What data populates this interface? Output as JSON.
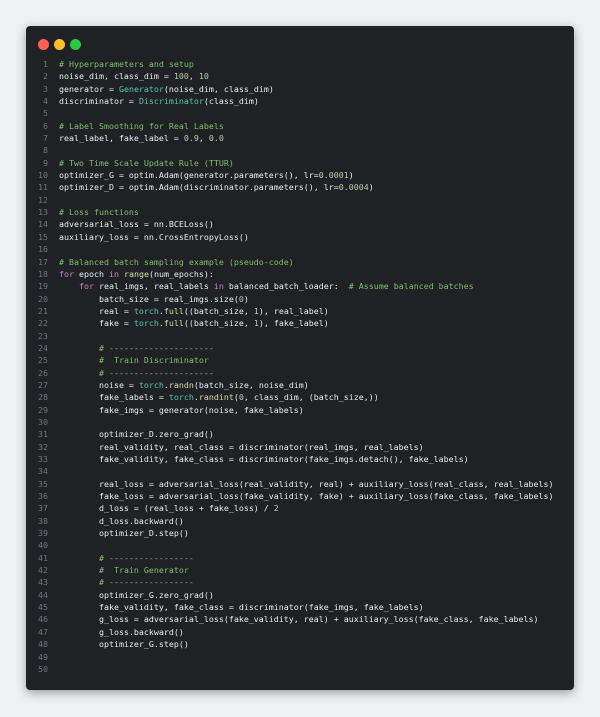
{
  "window": {
    "controls": [
      "close",
      "minimize",
      "zoom"
    ],
    "colors": {
      "close": "#ff5f56",
      "minimize": "#ffbd2e",
      "zoom": "#27c93f",
      "background": "#1f2124"
    }
  },
  "code": {
    "lines": [
      {
        "n": "1",
        "t": [
          [
            "c",
            "# Hyperparameters and setup"
          ]
        ]
      },
      {
        "n": "2",
        "t": [
          [
            "p",
            "noise_dim, class_dim = "
          ],
          [
            "n",
            "100"
          ],
          [
            "p",
            ", "
          ],
          [
            "n",
            "10"
          ]
        ]
      },
      {
        "n": "3",
        "t": [
          [
            "p",
            "generator = "
          ],
          [
            "t",
            "Generator"
          ],
          [
            "p",
            "(noise_dim, class_dim)"
          ]
        ]
      },
      {
        "n": "4",
        "t": [
          [
            "p",
            "discriminator = "
          ],
          [
            "t",
            "Discriminator"
          ],
          [
            "p",
            "(class_dim)"
          ]
        ]
      },
      {
        "n": "5",
        "t": []
      },
      {
        "n": "6",
        "t": [
          [
            "c",
            "# Label Smoothing for Real Labels"
          ]
        ]
      },
      {
        "n": "7",
        "t": [
          [
            "p",
            "real_label, fake_label = "
          ],
          [
            "n",
            "0.9"
          ],
          [
            "p",
            ", "
          ],
          [
            "n",
            "0.0"
          ]
        ]
      },
      {
        "n": "8",
        "t": []
      },
      {
        "n": "9",
        "t": [
          [
            "c",
            "# Two Time Scale Update Rule (TTUR)"
          ]
        ]
      },
      {
        "n": "10",
        "t": [
          [
            "p",
            "optimizer_G = optim.Adam(generator.parameters(), lr="
          ],
          [
            "n",
            "0.0001"
          ],
          [
            "p",
            ")"
          ]
        ]
      },
      {
        "n": "11",
        "t": [
          [
            "p",
            "optimizer_D = optim.Adam(discriminator.parameters(), lr="
          ],
          [
            "n",
            "0.0004"
          ],
          [
            "p",
            ")"
          ]
        ]
      },
      {
        "n": "12",
        "t": []
      },
      {
        "n": "13",
        "t": [
          [
            "c",
            "# Loss functions"
          ]
        ]
      },
      {
        "n": "14",
        "t": [
          [
            "p",
            "adversarial_loss = nn.BCELoss()"
          ]
        ]
      },
      {
        "n": "15",
        "t": [
          [
            "p",
            "auxiliary_loss = nn.CrossEntropyLoss()"
          ]
        ]
      },
      {
        "n": "16",
        "t": []
      },
      {
        "n": "17",
        "t": [
          [
            "c",
            "# Balanced batch sampling example (pseudo-code)"
          ]
        ]
      },
      {
        "n": "18",
        "t": [
          [
            "k",
            "for"
          ],
          [
            "p",
            " epoch "
          ],
          [
            "k",
            "in"
          ],
          [
            "p",
            " "
          ],
          [
            "f",
            "range"
          ],
          [
            "p",
            "(num_epochs):"
          ]
        ]
      },
      {
        "n": "19",
        "t": [
          [
            "p",
            "    "
          ],
          [
            "k",
            "for"
          ],
          [
            "p",
            " real_imgs, real_labels "
          ],
          [
            "k",
            "in"
          ],
          [
            "p",
            " balanced_batch_loader:  "
          ],
          [
            "c",
            "# Assume balanced batches"
          ]
        ]
      },
      {
        "n": "20",
        "t": [
          [
            "p",
            "        batch_size = real_imgs.size("
          ],
          [
            "n",
            "0"
          ],
          [
            "p",
            ")"
          ]
        ]
      },
      {
        "n": "21",
        "t": [
          [
            "p",
            "        real = "
          ],
          [
            "t",
            "torch"
          ],
          [
            "p",
            "."
          ],
          [
            "f",
            "full"
          ],
          [
            "p",
            "((batch_size, "
          ],
          [
            "n",
            "1"
          ],
          [
            "p",
            "), real_label)"
          ]
        ]
      },
      {
        "n": "22",
        "t": [
          [
            "p",
            "        fake = "
          ],
          [
            "t",
            "torch"
          ],
          [
            "p",
            "."
          ],
          [
            "f",
            "full"
          ],
          [
            "p",
            "((batch_size, "
          ],
          [
            "n",
            "1"
          ],
          [
            "p",
            "), fake_label)"
          ]
        ]
      },
      {
        "n": "23",
        "t": []
      },
      {
        "n": "24",
        "t": [
          [
            "p",
            "        "
          ],
          [
            "c",
            "# ---------------------"
          ]
        ]
      },
      {
        "n": "25",
        "t": [
          [
            "p",
            "        "
          ],
          [
            "c",
            "#  Train Discriminator"
          ]
        ]
      },
      {
        "n": "26",
        "t": [
          [
            "p",
            "        "
          ],
          [
            "c",
            "# ---------------------"
          ]
        ]
      },
      {
        "n": "27",
        "t": [
          [
            "p",
            "        noise = "
          ],
          [
            "t",
            "torch"
          ],
          [
            "p",
            "."
          ],
          [
            "f",
            "randn"
          ],
          [
            "p",
            "(batch_size, noise_dim)"
          ]
        ]
      },
      {
        "n": "28",
        "t": [
          [
            "p",
            "        fake_labels = "
          ],
          [
            "t",
            "torch"
          ],
          [
            "p",
            "."
          ],
          [
            "f",
            "randint"
          ],
          [
            "p",
            "("
          ],
          [
            "n",
            "0"
          ],
          [
            "p",
            ", class_dim, (batch_size,))"
          ]
        ]
      },
      {
        "n": "29",
        "t": [
          [
            "p",
            "        fake_imgs = generator(noise, fake_labels)"
          ]
        ]
      },
      {
        "n": "30",
        "t": []
      },
      {
        "n": "31",
        "t": [
          [
            "p",
            "        optimizer_D.zero_grad()"
          ]
        ]
      },
      {
        "n": "32",
        "t": [
          [
            "p",
            "        real_validity, real_class = discriminator(real_imgs, real_labels)"
          ]
        ]
      },
      {
        "n": "33",
        "t": [
          [
            "p",
            "        fake_validity, fake_class = discriminator(fake_imgs.detach(), fake_labels)"
          ]
        ]
      },
      {
        "n": "34",
        "t": []
      },
      {
        "n": "35",
        "t": [
          [
            "p",
            "        real_loss = adversarial_loss(real_validity, real) + auxiliary_loss(real_class, real_labels)"
          ]
        ]
      },
      {
        "n": "36",
        "t": [
          [
            "p",
            "        fake_loss = adversarial_loss(fake_validity, fake) + auxiliary_loss(fake_class, fake_labels)"
          ]
        ]
      },
      {
        "n": "37",
        "t": [
          [
            "p",
            "        d_loss = (real_loss + fake_loss) / "
          ],
          [
            "n",
            "2"
          ]
        ]
      },
      {
        "n": "38",
        "t": [
          [
            "p",
            "        d_loss.backward()"
          ]
        ]
      },
      {
        "n": "39",
        "t": [
          [
            "p",
            "        optimizer_D.step()"
          ]
        ]
      },
      {
        "n": "40",
        "t": []
      },
      {
        "n": "41",
        "t": [
          [
            "p",
            "        "
          ],
          [
            "c",
            "# -----------------"
          ]
        ]
      },
      {
        "n": "42",
        "t": [
          [
            "p",
            "        "
          ],
          [
            "c",
            "#  Train Generator"
          ]
        ]
      },
      {
        "n": "43",
        "t": [
          [
            "p",
            "        "
          ],
          [
            "c",
            "# -----------------"
          ]
        ]
      },
      {
        "n": "44",
        "t": [
          [
            "p",
            "        optimizer_G.zero_grad()"
          ]
        ]
      },
      {
        "n": "45",
        "t": [
          [
            "p",
            "        fake_validity, fake_class = discriminator(fake_imgs, fake_labels)"
          ]
        ]
      },
      {
        "n": "46",
        "t": [
          [
            "p",
            "        g_loss = adversarial_loss(fake_validity, real) + auxiliary_loss(fake_class, fake_labels)"
          ]
        ]
      },
      {
        "n": "47",
        "t": [
          [
            "p",
            "        g_loss.backward()"
          ]
        ]
      },
      {
        "n": "48",
        "t": [
          [
            "p",
            "        optimizer_G.step()"
          ]
        ]
      },
      {
        "n": "49",
        "t": []
      },
      {
        "n": "50",
        "t": []
      }
    ]
  }
}
